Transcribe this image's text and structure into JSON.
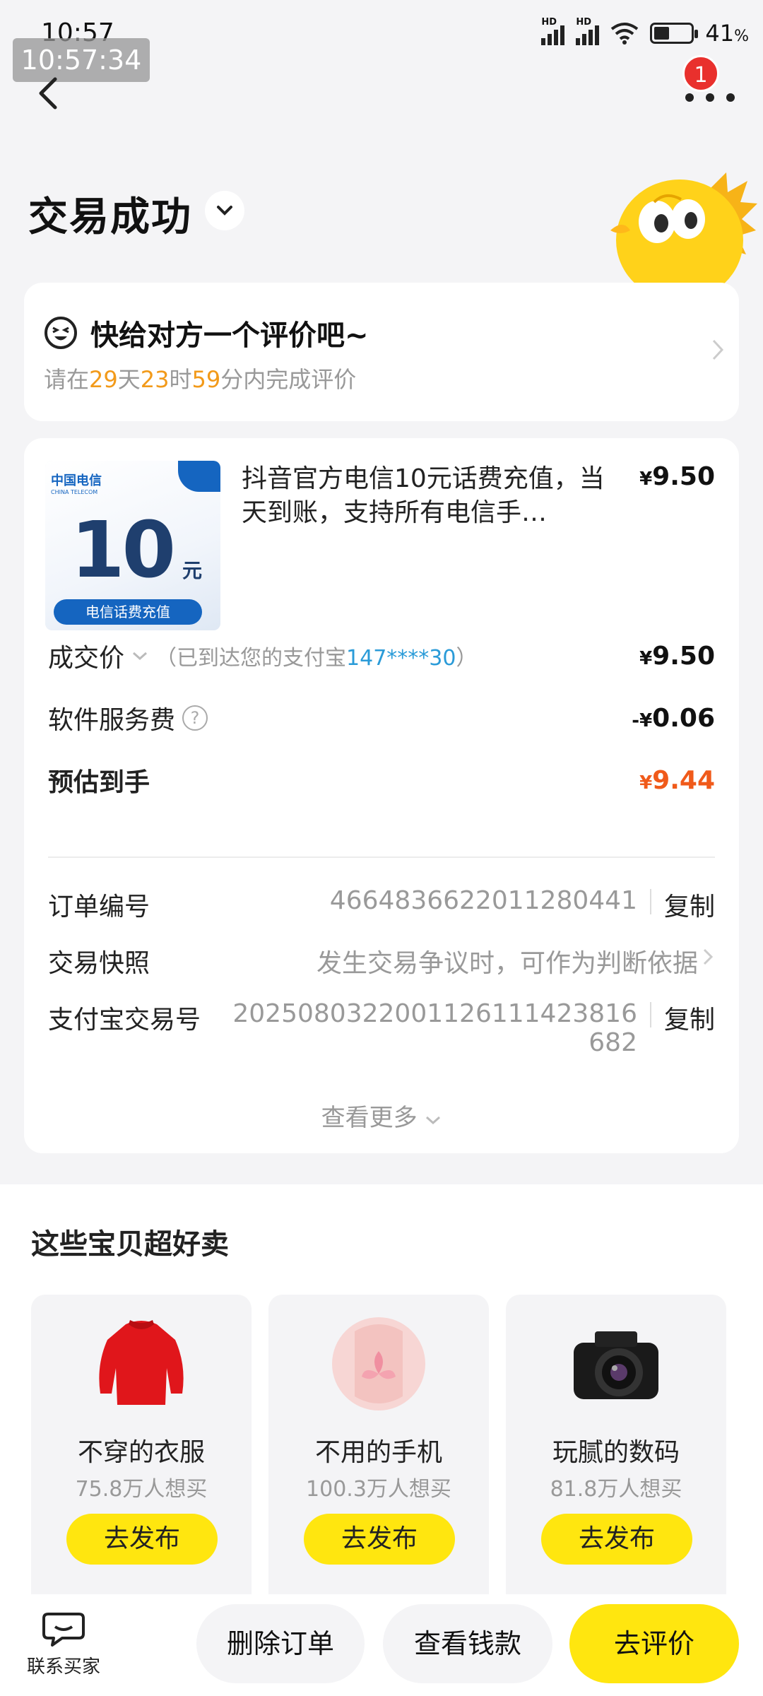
{
  "status_bar": {
    "time": "10:57",
    "overlay_time": "10:57:34",
    "battery_percent": "41",
    "battery_unit": "%",
    "network": "HD"
  },
  "header": {
    "notification_count": "1",
    "title": "交易成功"
  },
  "review_prompt": {
    "title": "快给对方一个评价吧~",
    "sub_prefix": "请在",
    "days": "29",
    "days_unit": "天",
    "hours": "23",
    "hours_unit": "时",
    "minutes": "59",
    "minutes_suffix": "分内完成评价"
  },
  "product": {
    "name": "抖音官方电信10元话费充值，当天到账，支持所有电信手…",
    "currency": "¥",
    "price": "9.50",
    "thumb": {
      "brand": "中国电信",
      "brand_en": "CHINA TELECOM",
      "amount": "10",
      "unit": "元",
      "caption": "电信话费充值"
    }
  },
  "pricing": {
    "deal_label": "成交价",
    "deal_note_prefix": "（已到达您的支付宝",
    "deal_account": "147****30",
    "deal_note_suffix": "）",
    "deal_currency": "¥",
    "deal_value": "9.50",
    "fee_label": "软件服务费",
    "fee_currency": "-¥",
    "fee_value": "0.06",
    "net_label": "预估到手",
    "net_currency": "¥",
    "net_value": "9.44"
  },
  "order_info": {
    "order_no_label": "订单编号",
    "order_no": "4664836622011280441",
    "copy_label": "复制",
    "snapshot_label": "交易快照",
    "snapshot_value": "发生交易争议时，可作为判断依据",
    "alipay_label": "支付宝交易号",
    "alipay_no_line1": "2025080322001126111423816",
    "alipay_no_line2": "682",
    "see_more": "查看更多"
  },
  "recommend": {
    "title": "这些宝贝超好卖",
    "items": [
      {
        "name": "不穿的衣服",
        "count": "75.8万人想买",
        "button": "去发布"
      },
      {
        "name": "不用的手机",
        "count": "100.3万人想买",
        "button": "去发布"
      },
      {
        "name": "玩腻的数码",
        "count": "81.8万人想买",
        "button": "去发布"
      }
    ]
  },
  "bottom_bar": {
    "contact": "联系买家",
    "delete": "删除订单",
    "view_money": "查看钱款",
    "review": "去评价"
  },
  "colors": {
    "accent_yellow": "#ffe60f",
    "highlight_orange": "#f29a1a",
    "net_orange": "#f05a1a",
    "link_blue": "#2a9bd8",
    "badge_red": "#e9302d"
  }
}
